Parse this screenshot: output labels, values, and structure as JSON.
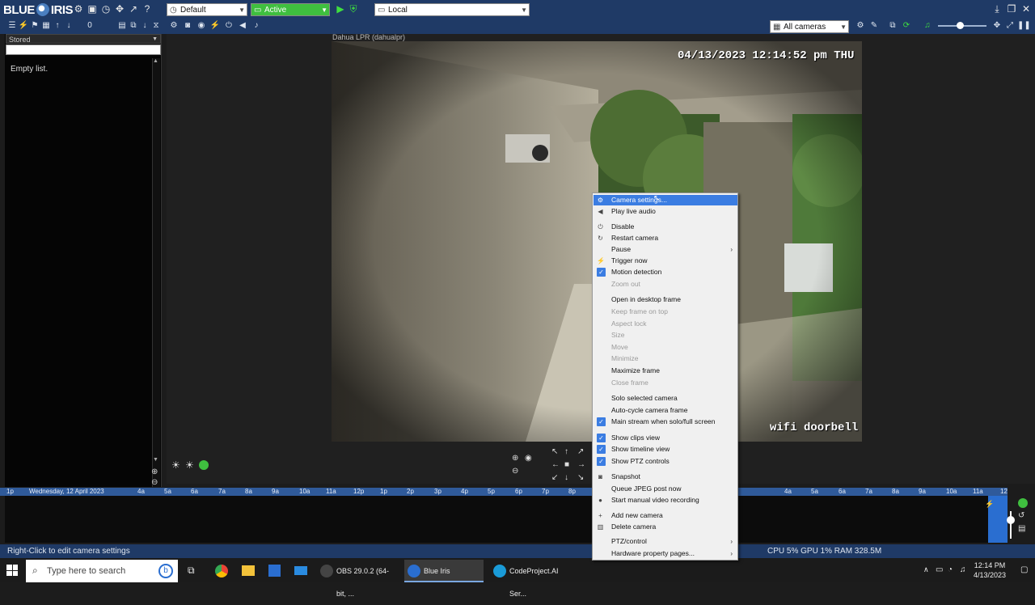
{
  "topbar": {
    "logo_text_a": "BLUE",
    "logo_text_b": "IRIS",
    "profile_combo": "Default",
    "state_combo": "Active",
    "server_combo": "Local"
  },
  "toolbar2": {
    "camera_group_combo": "All cameras"
  },
  "left_panel": {
    "stored_combo": "Stored",
    "search_placeholder": "",
    "empty_text": "Empty list."
  },
  "camera": {
    "title": "Dahua LPR (dahualpr)",
    "timestamp": "04/13/2023 12:14:52 pm THU",
    "overlay_label": "wifi doorbell"
  },
  "context_menu": {
    "items": [
      {
        "label": "Camera settings...",
        "icon": "gear-icon",
        "state": "highlighted"
      },
      {
        "label": "Play live audio",
        "icon": "speaker-icon",
        "state": "normal"
      },
      {
        "label": "Disable",
        "icon": "power-icon",
        "state": "normal"
      },
      {
        "label": "Restart camera",
        "icon": "restart-icon",
        "state": "normal"
      },
      {
        "label": "Pause",
        "icon": "",
        "state": "submenu"
      },
      {
        "label": "Trigger now",
        "icon": "lightning-icon",
        "state": "normal"
      },
      {
        "label": "Motion detection",
        "icon": "",
        "state": "checked"
      },
      {
        "label": "Zoom out",
        "icon": "",
        "state": "disabled"
      },
      {
        "label": "Open in desktop frame",
        "icon": "",
        "state": "normal"
      },
      {
        "label": "Keep frame on top",
        "icon": "",
        "state": "disabled"
      },
      {
        "label": "Aspect lock",
        "icon": "",
        "state": "disabled"
      },
      {
        "label": "Size",
        "icon": "",
        "state": "disabled"
      },
      {
        "label": "Move",
        "icon": "",
        "state": "disabled"
      },
      {
        "label": "Minimize",
        "icon": "",
        "state": "disabled"
      },
      {
        "label": "Maximize frame",
        "icon": "",
        "state": "normal"
      },
      {
        "label": "Close frame",
        "icon": "",
        "state": "disabled"
      },
      {
        "label": "Solo selected camera",
        "icon": "",
        "state": "normal"
      },
      {
        "label": "Auto-cycle camera frame",
        "icon": "",
        "state": "normal"
      },
      {
        "label": "Main stream when solo/full screen",
        "icon": "",
        "state": "checked"
      },
      {
        "label": "Show clips view",
        "icon": "",
        "state": "checked"
      },
      {
        "label": "Show timeline view",
        "icon": "",
        "state": "checked"
      },
      {
        "label": "Show PTZ controls",
        "icon": "",
        "state": "checked"
      },
      {
        "label": "Snapshot",
        "icon": "camera-icon",
        "state": "normal"
      },
      {
        "label": "Queue JPEG post now",
        "icon": "",
        "state": "normal"
      },
      {
        "label": "Start manual video recording",
        "icon": "record-icon",
        "state": "normal"
      },
      {
        "label": "Add new camera",
        "icon": "plus-icon",
        "state": "normal"
      },
      {
        "label": "Delete camera",
        "icon": "trash-icon",
        "state": "normal"
      },
      {
        "label": "PTZ/control",
        "icon": "",
        "state": "submenu"
      },
      {
        "label": "Hardware property pages...",
        "icon": "",
        "state": "submenu"
      }
    ]
  },
  "timeline": {
    "date_label": "Wednesday, 12 April 2023",
    "ticks": [
      "1p",
      "4a",
      "5a",
      "6a",
      "7a",
      "8a",
      "9a",
      "10a",
      "11a",
      "12p",
      "1p",
      "2p",
      "3p",
      "4p",
      "5p",
      "6p",
      "7p",
      "8p",
      "4a",
      "5a",
      "6a",
      "7a",
      "8a",
      "9a",
      "10a",
      "11a",
      "12"
    ]
  },
  "status_bar": {
    "left_text": "Right-Click to edit camera settings",
    "right_text": "CPU 5% GPU 1% RAM 328.5M"
  },
  "taskbar": {
    "search_placeholder": "Type here to search",
    "apps": [
      {
        "label": "OBS 29.0.2 (64-bit, ...",
        "active": false
      },
      {
        "label": "Blue Iris",
        "active": true
      },
      {
        "label": "CodeProject.AI Ser...",
        "active": false
      }
    ],
    "clock_time": "12:14 PM",
    "clock_date": "4/13/2023"
  },
  "colors": {
    "chrome_blue": "#1f3a66",
    "timeline_blue": "#2f5a9a",
    "highlight": "#3b7de2",
    "active_green": "#3fbf3f"
  }
}
